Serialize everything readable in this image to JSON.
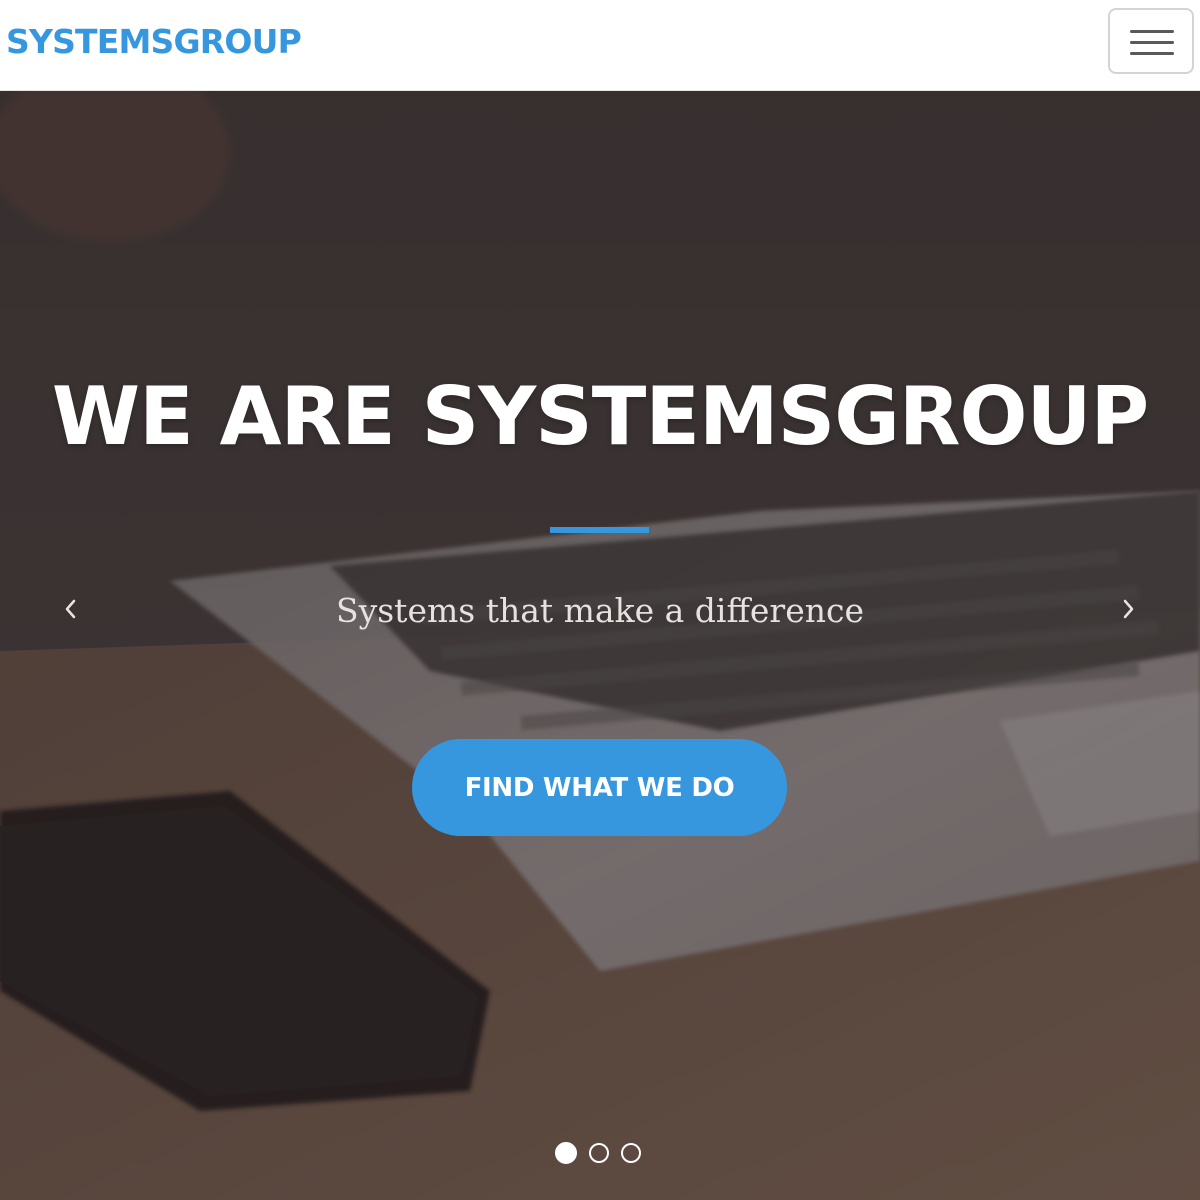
{
  "navbar": {
    "brand": "SYSTEMSGROUP",
    "menu_icon": "hamburger-menu-icon"
  },
  "hero": {
    "title": "WE ARE SYSTEMSGROUP",
    "subtitle": "Systems that make a difference",
    "cta_label": "FIND WHAT WE DO",
    "prev_icon": "chevron-left-icon",
    "next_icon": "chevron-right-icon",
    "slides": {
      "count": 3,
      "active": 1
    }
  },
  "colors": {
    "accent": "#3797de",
    "overlay": "#4a4140",
    "brand_text": "#3797de"
  }
}
